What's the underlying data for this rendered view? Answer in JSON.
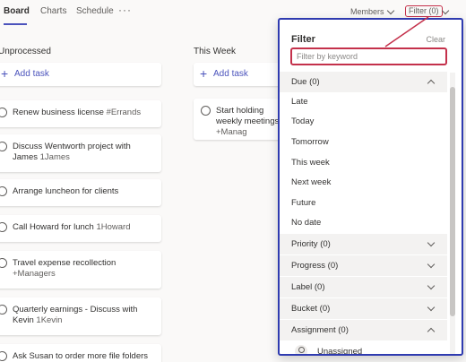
{
  "tabs": {
    "board": "Board",
    "charts": "Charts",
    "schedule": "Schedule",
    "more": "···"
  },
  "toolbar": {
    "members": "Members",
    "filter": "Filter (0)"
  },
  "columns": [
    {
      "title": "Unprocessed",
      "add_task": "Add task",
      "tasks": [
        {
          "text": "Renew business license",
          "meta": "#Errands"
        },
        {
          "text": "Discuss Wentworth project with James",
          "meta": "1James"
        },
        {
          "text": "Arrange luncheon for clients",
          "meta": ""
        },
        {
          "text": "Call Howard for lunch",
          "meta": "1Howard"
        },
        {
          "text": "Travel expense recollection",
          "meta": "+Managers"
        },
        {
          "text": "Quarterly earnings - Discuss with Kevin",
          "meta": "1Kevin"
        },
        {
          "text": "Ask Susan to order more file folders",
          "meta": ""
        }
      ]
    },
    {
      "title": "This Week",
      "add_task": "Add task",
      "tasks": [
        {
          "text": "Start holding weekly meetings",
          "meta": "+Manag"
        }
      ]
    }
  ],
  "filter_panel": {
    "title": "Filter",
    "clear": "Clear",
    "keyword_placeholder": "Filter by keyword",
    "keyword_value": "",
    "sections": {
      "due": "Due (0)",
      "priority": "Priority (0)",
      "progress": "Progress (0)",
      "label": "Label (0)",
      "bucket": "Bucket (0)",
      "assignment": "Assignment (0)"
    },
    "due_options": [
      "Late",
      "Today",
      "Tomorrow",
      "This week",
      "Next week",
      "Future",
      "No date"
    ],
    "assignment_options": [
      "Unassigned"
    ]
  },
  "colors": {
    "accent": "#4b53bc",
    "highlight_red": "#c4314b",
    "panel_border": "#2f3bb0"
  }
}
